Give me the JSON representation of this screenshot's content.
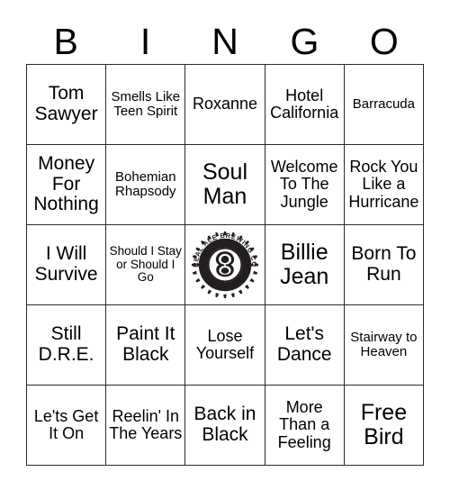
{
  "header": {
    "letters": [
      "B",
      "I",
      "N",
      "G",
      "O"
    ]
  },
  "grid": {
    "rows": [
      [
        {
          "text": "Tom Sawyer",
          "size": "lg"
        },
        {
          "text": "Smells Like Teen Spirit",
          "size": "sm"
        },
        {
          "text": "Roxanne",
          "size": "md"
        },
        {
          "text": "Hotel California",
          "size": "md"
        },
        {
          "text": "Barracuda",
          "size": "sm"
        }
      ],
      [
        {
          "text": "Money For Nothing",
          "size": "lg"
        },
        {
          "text": "Bohemian Rhapsody",
          "size": "sm"
        },
        {
          "text": "Soul Man",
          "size": "xl"
        },
        {
          "text": "Welcome To The Jungle",
          "size": "md"
        },
        {
          "text": "Rock You Like a Hurricane",
          "size": "md"
        }
      ],
      [
        {
          "text": "I Will Survive",
          "size": "lg"
        },
        {
          "text": "Should I Stay or Should I Go",
          "size": "xs"
        },
        {
          "text": "",
          "size": "md",
          "logo": true
        },
        {
          "text": "Billie Jean",
          "size": "xl"
        },
        {
          "text": "Born To Run",
          "size": "lg"
        }
      ],
      [
        {
          "text": "Still D.R.E.",
          "size": "lg"
        },
        {
          "text": "Paint It Black",
          "size": "lg"
        },
        {
          "text": "Lose Yourself",
          "size": "md"
        },
        {
          "text": "Let's Dance",
          "size": "lg"
        },
        {
          "text": "Stairway to Heaven",
          "size": "md"
        }
      ],
      [
        {
          "text": "Le'ts Get It On",
          "size": "md"
        },
        {
          "text": "Reelin' In The Years",
          "size": "md"
        },
        {
          "text": "Back in Black",
          "size": "lg"
        },
        {
          "text": "More Than a Feeling",
          "size": "md"
        },
        {
          "text": "Free Bird",
          "size": "xl"
        }
      ]
    ]
  },
  "logo": {
    "name": "real-ale-brewing-co-logo",
    "top_text": "REAL ALE BREWING CO",
    "bottom_text": "BLANCO, TEXAS",
    "color": "#231f20",
    "background": "#ffffff"
  },
  "colors": {
    "text": "#000000",
    "border": "#2b2b2b",
    "background": "#ffffff"
  }
}
